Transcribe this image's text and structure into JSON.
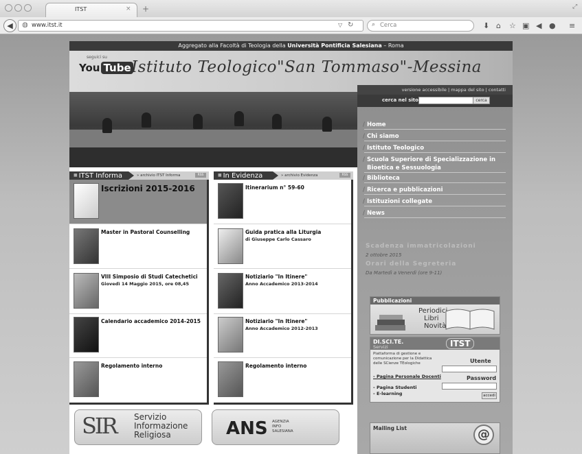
{
  "browser": {
    "tab_title": "ITST",
    "tab_close": "×",
    "new_tab": "+",
    "url": "www.itst.it",
    "search_placeholder": "Cerca",
    "toolbar_icons": [
      "download-icon",
      "home-icon",
      "bookmark-star-icon",
      "bookmarks-icon",
      "share-icon",
      "chat-icon",
      "menu-icon"
    ]
  },
  "site": {
    "top_strip_pre": "Aggregato alla Facoltà di Teologia della ",
    "top_strip_bold": "Università Pontificia Salesiana",
    "top_strip_post": " – Roma",
    "youtube_small": "seguici su",
    "youtube_you": "You",
    "youtube_tube": "Tube",
    "title": "Istituto Teologico\"San Tommaso\"-Messina",
    "utility_links": "versione accessibile  |  mappa del sito  |  contatti",
    "search_label": "cerca nel sito",
    "search_button": "cerca",
    "nav": [
      {
        "label": "Home"
      },
      {
        "label": "Chi siamo"
      },
      {
        "label": "Istituto Teologico"
      },
      {
        "label": "Scuola Superiore di Specializzazione in Bioetica e Sessuologia"
      },
      {
        "label": "Biblioteca"
      },
      {
        "label": "Ricerca e pubblicazioni"
      },
      {
        "label": "Istituzioni collegate"
      },
      {
        "label": "News"
      }
    ],
    "scadenza_title": "Scadenza immatricolazioni",
    "scadenza_date": "2 ottobre 2015",
    "orari_title": "Orari della Segreteria",
    "orari_text": "Da Martedì a Venerdì (ore 9-11)",
    "pub_title": "Pubblicazioni",
    "pub_items": [
      "Periodici",
      "Libri",
      "Novità"
    ],
    "discite": {
      "title": "DI.SCI.TE.",
      "servizi": "Servizi",
      "logo": "ITST",
      "desc": "Piattaforma di gestione e comunicazione per la Didattica delle SCienze TEologiche",
      "user_label": "Utente",
      "pass_label": "Password",
      "accedi": "accedi",
      "link1": "- Pagina Personale Docenti",
      "link2": "- Pagina Studenti",
      "link3": "- E-learning"
    },
    "mailing_title": "Mailing List",
    "mail_icon_text": "@"
  },
  "informa": {
    "title": "ITST Informa",
    "archive": "» archivio ITST Informa",
    "rss": "RSS",
    "items": [
      {
        "title": "Iscrizioni 2015-2016",
        "sub": ""
      },
      {
        "title": "Master in Pastoral Counselling",
        "sub": ""
      },
      {
        "title": "VIII Simposio di Studi Catechetici",
        "sub": "Giovedì 14 Maggio 2015, ore 08,45"
      },
      {
        "title": "Calendario accademico 2014-2015",
        "sub": ""
      },
      {
        "title": "Regolamento interno",
        "sub": ""
      }
    ]
  },
  "evidenza": {
    "title": "In Evidenza",
    "archive": "» archivio Evidenza",
    "rss": "RSS",
    "items": [
      {
        "title": "Itinerarium n° 59-60",
        "sub": ""
      },
      {
        "title": "Guida pratica alla Liturgia",
        "sub": "di Giuseppe Carlo Cassaro"
      },
      {
        "title": "Notiziario \"In Itinere\"",
        "sub": "Anno Accademico 2013-2014"
      },
      {
        "title": "Notiziario \"In Itinere\"",
        "sub": "Anno Accademico 2012-2013"
      },
      {
        "title": "Regolamento interno",
        "sub": ""
      }
    ]
  },
  "footer_logos": {
    "sir_logo": "SIR",
    "sir_line1": "Servizio",
    "sir_line2": "Informazione",
    "sir_line3": "Religiosa",
    "ans_logo": "ANS",
    "ans_line1": "AGENZIA",
    "ans_line2": "INFO",
    "ans_line3": "SALESIANA"
  }
}
